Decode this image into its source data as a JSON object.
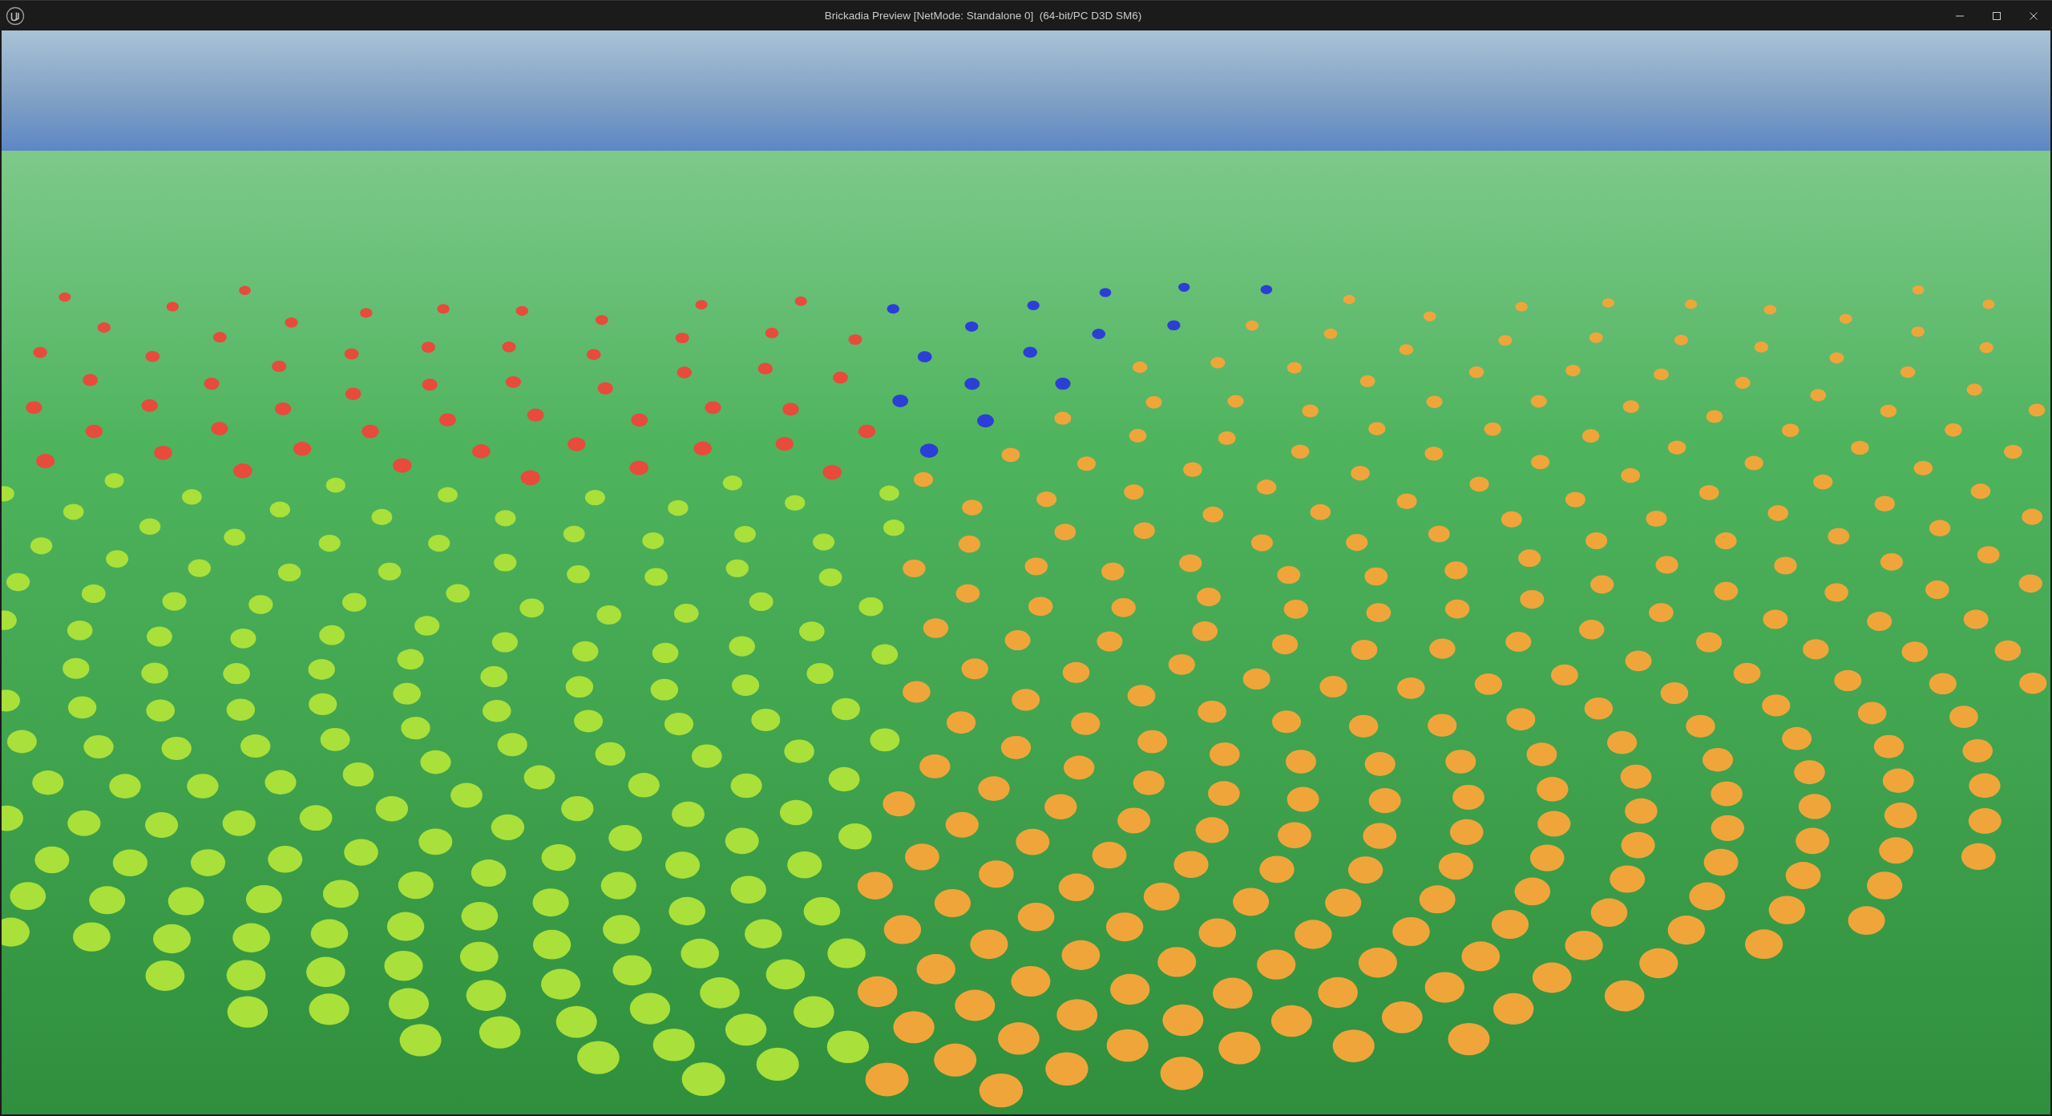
{
  "window": {
    "title": "Brickadia Preview [NetMode: Standalone 0]  (64-bit/PC D3D SM6)"
  }
}
